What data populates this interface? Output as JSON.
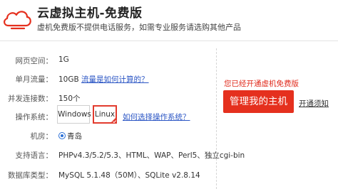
{
  "header": {
    "title": "云虚拟主机-免费版",
    "subtitle": "虚机免费版不提供电话服务，如需专业服务请选购其他产品",
    "logo_icon": "cloud-icon",
    "accent_color": "#e5301e"
  },
  "specs": {
    "webspace": {
      "label": "网页空间：",
      "value": "1G"
    },
    "traffic": {
      "label": "单月流量：",
      "value": "10GB",
      "link": "流量是如何计算的？"
    },
    "concurrency": {
      "label": "并发连接数：",
      "value": "150个"
    },
    "os": {
      "label": "操作系统：",
      "options": [
        "Windows",
        "Linux"
      ],
      "selected": "Linux",
      "help_link": "如何选择操作系统？"
    },
    "datacenter": {
      "label": "机房：",
      "value": "青岛"
    },
    "languages": {
      "label": "支持语言：",
      "value": "PHPv4.3/5.2/5.3、HTML、WAP、Perl5、独立cgi-bin"
    },
    "database": {
      "label": "数据库类型：",
      "value": "MySQL 5.1.48（50M）、SQLite v2.8.14"
    }
  },
  "side": {
    "notice": "您已经开通虚机免费版",
    "manage_button": "管理我的主机",
    "activation_link": "开通须知"
  }
}
